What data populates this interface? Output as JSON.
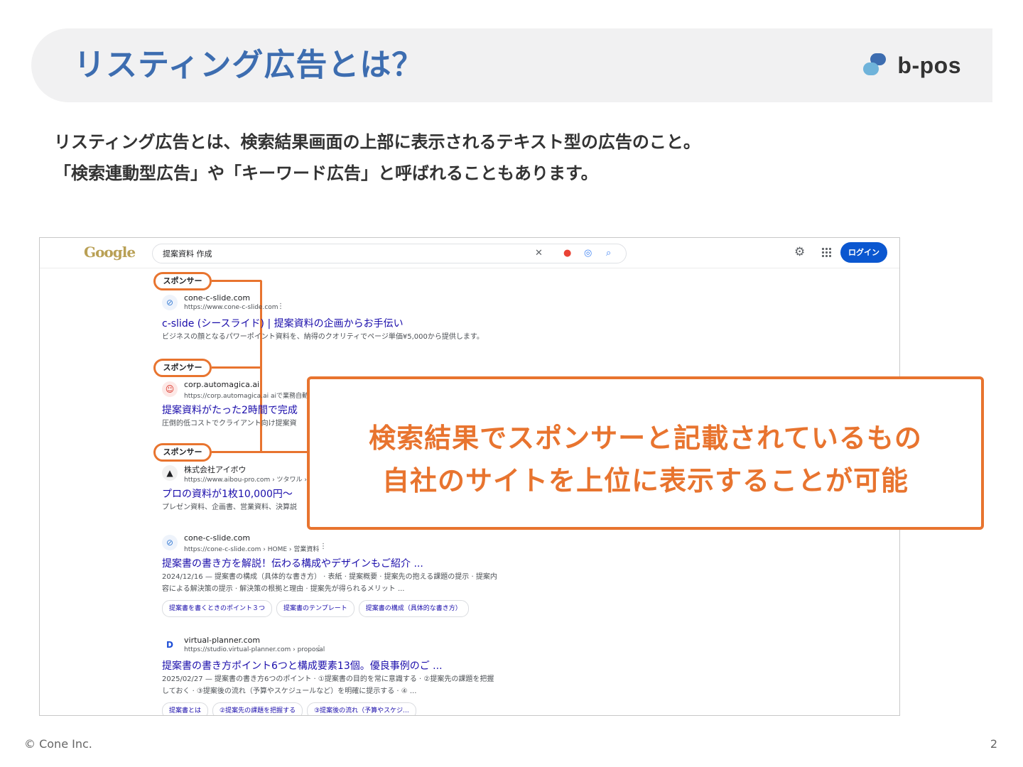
{
  "header": {
    "title": "リスティング広告とは？",
    "brand": "b-pos"
  },
  "intro": {
    "line1": "リスティング広告とは、検索結果画面の上部に表示されるテキスト型の広告のこと。",
    "line2": "「検索連動型広告」や「キーワード広告」と呼ばれることもあります。"
  },
  "screenshot": {
    "logo": "Google",
    "search_query": "提案資料 作成",
    "login_label": "ログイン",
    "sponsor_label": "スポンサー",
    "results": [
      {
        "site": "cone-c-slide.com",
        "url": "https://www.cone-c-slide.com",
        "title": "c-slide (シースライド) | 提案資料の企画からお手伝い",
        "desc1": "ビジネスの顔となるパワーポイント資料を、納得のクオリティでページ単価¥5,000から提供します。"
      },
      {
        "site": "corp.automagica.ai",
        "url": "https://corp.automagica.ai",
        "url_suffix": "aiで業務自動化",
        "title": "提案資料がたった2時間で完成",
        "desc1": "圧倒的低コストでクライアント向け提案資"
      },
      {
        "site": "株式会社アイボウ",
        "url": "https://www.aibou-pro.com › ツタワル › 資",
        "title": "プロの資料が1枚10,000円〜",
        "desc1": "プレゼン資料、企画書、営業資料、決算説"
      },
      {
        "site": "cone-c-slide.com",
        "url": "https://cone-c-slide.com › HOME › 営業資料",
        "title": "提案書の書き方を解説！伝わる構成やデザインもご紹介 ...",
        "desc1": "2024/12/16 — 提案書の構成（具体的な書き方） · 表紙 · 提案概要 · 提案先の抱える課題の提示 · 提案内",
        "desc2": "容による解決策の提示 · 解決策の根拠と理由 · 提案先が得られるメリット ...",
        "chips": [
          "提案書を書くときのポイント３つ",
          "提案書のテンプレート",
          "提案書の構成（具体的な書き方）"
        ]
      },
      {
        "site": "virtual-planner.com",
        "url": "https://studio.virtual-planner.com › proposal",
        "title": "提案書の書き方ポイント6つと構成要素13個。優良事例のご ...",
        "desc1": "2025/02/27 — 提案書の書き方6つのポイント · ①提案書の目的を常に意識する · ②提案先の課題を把握",
        "desc2": "しておく · ③提案後の流れ（予算やスケジュールなど）を明確に提示する · ④ ...",
        "chips": [
          "提案書とは",
          "②提案先の課題を把握する",
          "③提案後の流れ（予算やスケジ..."
        ]
      }
    ]
  },
  "callout": {
    "line1": "検索結果でスポンサーと記載されているもの",
    "line2": "自社のサイトを上位に表示することが可能"
  },
  "footer": {
    "copyright": "© Cone Inc.",
    "page": "2"
  },
  "colors": {
    "title_blue": "#3d6db0",
    "accent_orange": "#e8742f",
    "link_blue": "#1a0dab",
    "button_blue": "#0b57d0"
  }
}
